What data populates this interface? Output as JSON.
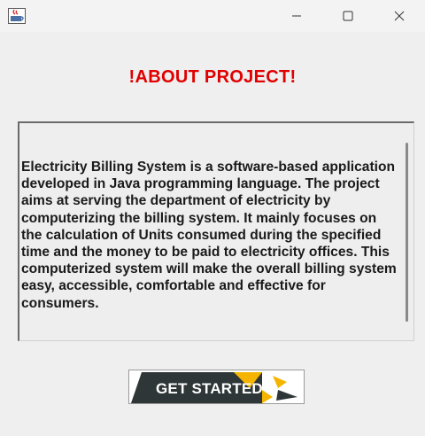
{
  "window": {
    "icon": "java-cup-icon",
    "controls": [
      "minimize-icon",
      "maximize-icon",
      "close-icon"
    ]
  },
  "heading": "!ABOUT PROJECT!",
  "description": "Electricity Billing System is a software-based application developed in Java programming language. The project aims at serving the department of electricity by computerizing the billing system. It mainly focuses on the calculation of Units consumed during the specified time and the money to be paid to electricity offices. This computerized system will make the overall billing system easy, accessible, comfortable and effective for consumers.",
  "button": {
    "label": "GET STARTED"
  },
  "colors": {
    "heading": "#e00000",
    "button_dark": "#2e3637",
    "button_accent": "#f4b400"
  }
}
